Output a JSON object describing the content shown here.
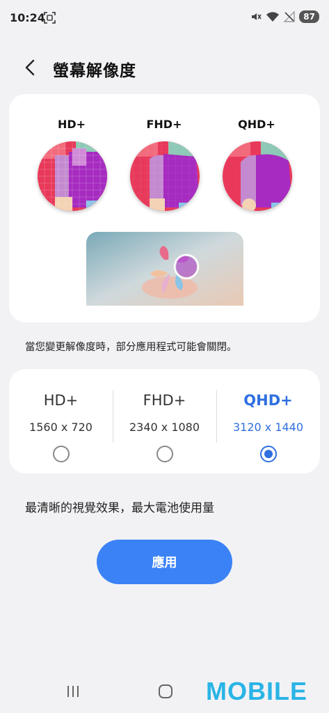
{
  "status": {
    "time": "10:24",
    "battery": "87",
    "icons": [
      "screenshot-icon",
      "mute-icon",
      "wifi-icon",
      "no-signal-icon",
      "battery-icon"
    ]
  },
  "header": {
    "back_icon": "chevron-left-icon",
    "title": "螢幕解像度"
  },
  "preview": {
    "labels": [
      "HD+",
      "FHD+",
      "QHD+"
    ]
  },
  "notice": "當您變更解像度時，部分應用程式可能會關閉。",
  "options": [
    {
      "name": "HD+",
      "size": "1560 x 720",
      "selected": false
    },
    {
      "name": "FHD+",
      "size": "2340 x 1080",
      "selected": false
    },
    {
      "name": "QHD+",
      "size": "3120 x 1440",
      "selected": true
    }
  ],
  "description": "最清晰的視覺效果，最大電池使用量",
  "apply_label": "應用",
  "nav": {
    "icons": [
      "recents-icon",
      "home-icon"
    ]
  },
  "watermark": "MOBILE",
  "colors": {
    "accent": "#2f6fe0",
    "button": "#3b82f6",
    "background": "#f2f2f5"
  }
}
